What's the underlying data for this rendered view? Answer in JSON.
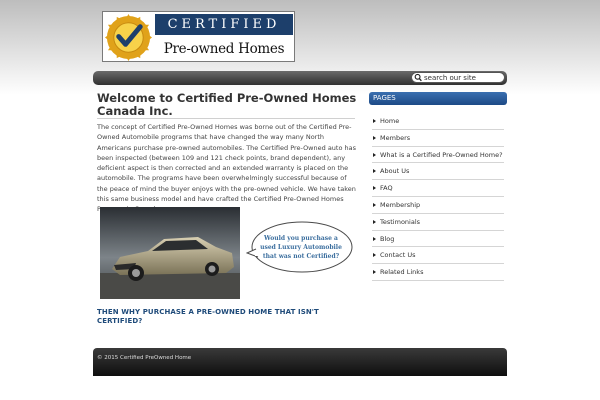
{
  "logo": {
    "band_text": "CERTIFIED",
    "sub_text": "Pre-owned Homes"
  },
  "search": {
    "placeholder": "search our site"
  },
  "main": {
    "title": "Welcome to Certified Pre-Owned Homes Canada Inc.",
    "paragraph": "The concept of Certified Pre-Owned Homes was borne out of the Certified Pre-Owned Automobile programs that have changed the way many North Americans purchase pre-owned automobiles.  The Certified Pre-Owned auto has been inspected (between 109 and 121 check points, brand dependent), any deficient aspect is then corrected and an extended warranty is placed on the automobile. The programs have been overwhelmingly successful because of the peace of mind the buyer enjoys with the pre-owned vehicle. We have taken this same business model and have crafted the Certified Pre-Owned Homes Program in Canada.",
    "bubble": "Would you purchase a used Luxury Automobile that was not Certified?",
    "question": "THEN WHY PURCHASE A PRE-OWNED HOME THAT ISN'T CERTIFIED?"
  },
  "sidebar": {
    "heading": "PAGES",
    "items": [
      {
        "label": "Home"
      },
      {
        "label": "Members"
      },
      {
        "label": "What is a Certified Pre-Owned Home?"
      },
      {
        "label": "About Us"
      },
      {
        "label": "FAQ"
      },
      {
        "label": "Membership"
      },
      {
        "label": "Testimonials"
      },
      {
        "label": "Blog"
      },
      {
        "label": "Contact Us"
      },
      {
        "label": "Related Links"
      }
    ]
  },
  "footer": {
    "copyright": "© 2015 Certified PreOwned Home"
  },
  "colors": {
    "accent": "#1d4a86",
    "title": "#333333",
    "question": "#1f4b7a",
    "bubble_text": "#3b6e9e"
  }
}
